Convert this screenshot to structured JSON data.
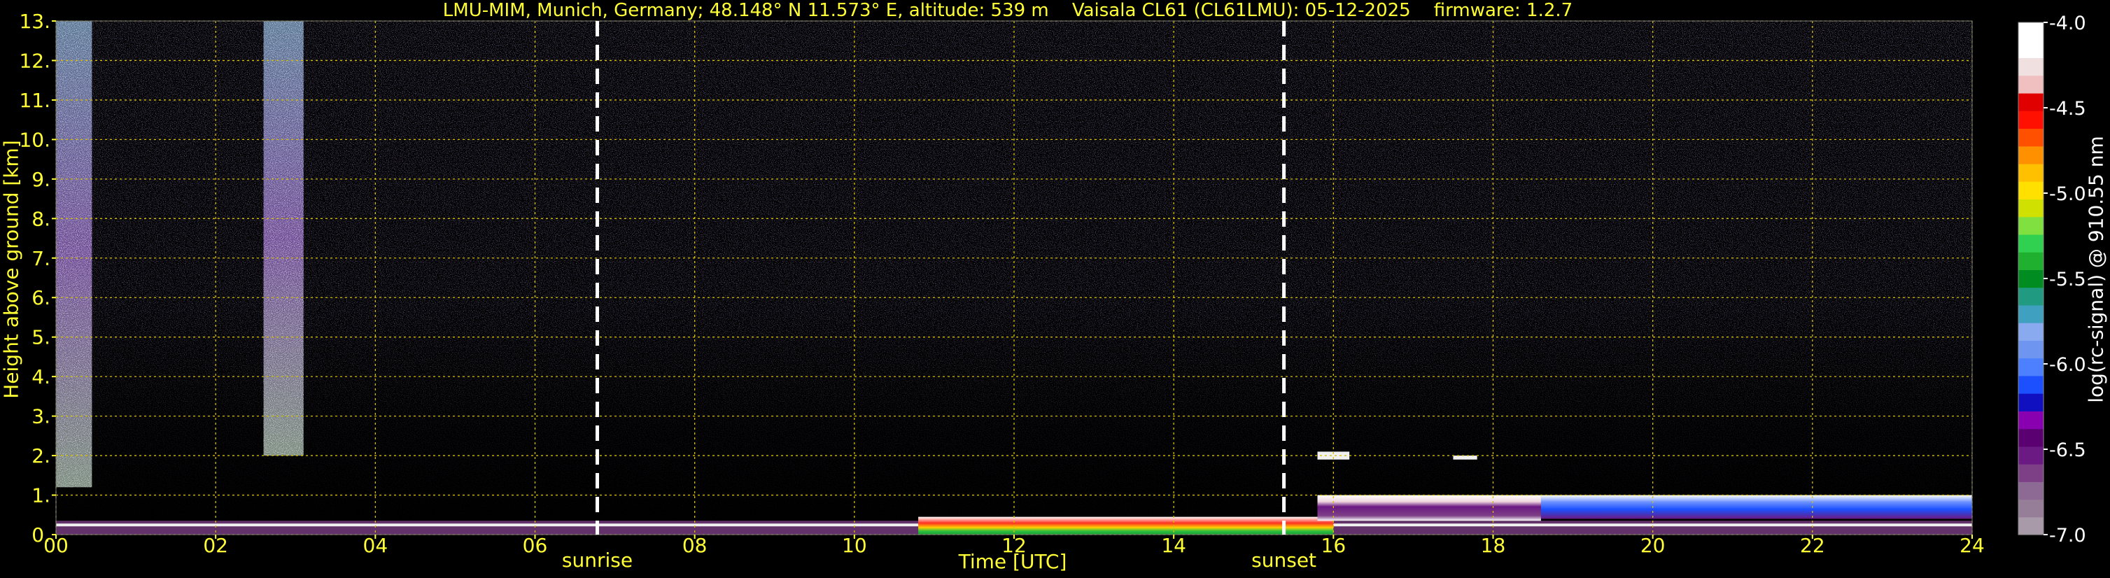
{
  "chart_data": {
    "type": "heatmap",
    "title": "LMU-MIM, Munich, Germany; 48.148° N 11.573° E, altitude: 539 m    Vaisala CL61 (CL61LMU): 05-12-2025    firmware: 1.2.7",
    "xlabel": "Time [UTC]",
    "ylabel": "Height above ground [km]",
    "colorbar_label": "log(rc-signal) @ 910.55 nm",
    "xlim": [
      0,
      24
    ],
    "ylim": [
      0,
      13
    ],
    "x_ticks": [
      "00",
      "02",
      "04",
      "06",
      "08",
      "10",
      "12",
      "14",
      "16",
      "18",
      "20",
      "22",
      "24"
    ],
    "y_ticks": [
      "0.",
      "1.",
      "2.",
      "3.",
      "4.",
      "5.",
      "6.",
      "7.",
      "8.",
      "9.",
      "10.",
      "11.",
      "12.",
      "13."
    ],
    "colorbar_range": [
      -7.0,
      -4.0
    ],
    "colorbar_ticks": [
      "-7.0",
      "-6.5",
      "-6.0",
      "-5.5",
      "-5.0",
      "-4.5",
      "-4.0"
    ],
    "colorbar_colors": [
      "#a89aa8",
      "#967d98",
      "#8c6a94",
      "#7d3f86",
      "#6a1a82",
      "#5a0070",
      "#8800b0",
      "#1010c0",
      "#1c50ff",
      "#4c80ff",
      "#6e96f0",
      "#8aaaf0",
      "#40a0c0",
      "#209a80",
      "#008c20",
      "#20b030",
      "#30d050",
      "#80e040",
      "#d0e000",
      "#ffe000",
      "#ffc000",
      "#ff9000",
      "#ff5000",
      "#ff1000",
      "#e00000",
      "#f0c0c0",
      "#f0e0e0",
      "#ffffff",
      "#ffffff"
    ],
    "grid": true,
    "annotations": [
      {
        "label": "sunrise",
        "x": 6.78
      },
      {
        "label": "sunset",
        "x": 15.38
      }
    ],
    "cloud_layers": [
      {
        "start": 10.8,
        "end": 16.0,
        "base_km": 0.0,
        "top_km": 0.45
      },
      {
        "start": 15.8,
        "end": 18.6,
        "base_km": 0.35,
        "top_km": 1.0
      },
      {
        "start": 18.6,
        "end": 24.0,
        "base_km": 0.4,
        "top_km": 1.0
      },
      {
        "start": 15.8,
        "end": 16.2,
        "base_km": 1.9,
        "top_km": 2.1
      },
      {
        "start": 17.5,
        "end": 17.8,
        "base_km": 1.9,
        "top_km": 2.0
      }
    ],
    "noise_columns": [
      {
        "start": 0.0,
        "end": 0.45,
        "top_km": 13.0,
        "bottom_km": 1.2
      },
      {
        "start": 2.6,
        "end": 3.1,
        "top_km": 13.0,
        "bottom_km": 2.0
      }
    ]
  }
}
